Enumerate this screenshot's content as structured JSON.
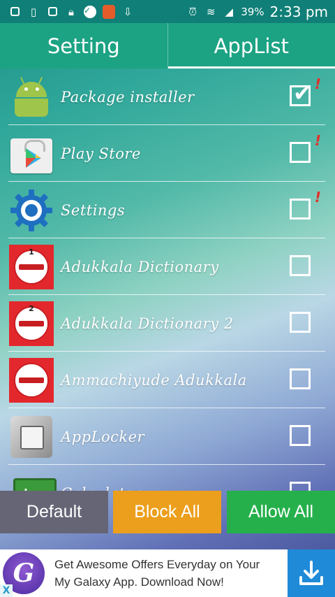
{
  "status_bar": {
    "battery": "39%",
    "time": "2:33 pm"
  },
  "tabs": [
    {
      "label": "Setting",
      "active": false
    },
    {
      "label": "AppList",
      "active": true
    }
  ],
  "apps": [
    {
      "name": "Package installer",
      "checked": true,
      "warning": true
    },
    {
      "name": "Play Store",
      "checked": false,
      "warning": true
    },
    {
      "name": "Settings",
      "checked": false,
      "warning": true
    },
    {
      "name": "Adukkala Dictionary",
      "checked": false,
      "warning": false,
      "badge": "1"
    },
    {
      "name": "Adukkala Dictionary 2",
      "checked": false,
      "warning": false,
      "badge": "2"
    },
    {
      "name": "Ammachiyude Adukkala",
      "checked": false,
      "warning": false
    },
    {
      "name": "AppLocker",
      "checked": false,
      "warning": false
    },
    {
      "name": "Calculator",
      "checked": false,
      "warning": false
    }
  ],
  "warning_mark": "!",
  "buttons": {
    "default_label": "Default",
    "block_all_label": "Block All",
    "allow_all_label": "Allow All"
  },
  "ad": {
    "text": "Get Awesome Offers Everyday on Your My Galaxy App. Download Now!",
    "close_label": "X"
  },
  "colors": {
    "tab_bar": "#1ca383",
    "default_button": "#666576",
    "block_button": "#ec9f1c",
    "allow_button": "#25b04b",
    "warning": "#e0302a"
  }
}
